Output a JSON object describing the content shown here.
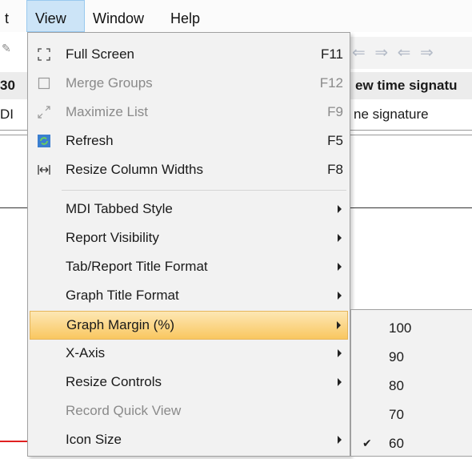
{
  "menubar": {
    "items": [
      {
        "label": "t"
      },
      {
        "label": "View"
      },
      {
        "label": "Window"
      },
      {
        "label": "Help"
      }
    ]
  },
  "background": {
    "header_left": "30",
    "header_right": "ew time signatu",
    "row_left": "DI",
    "row_right": "ne signature",
    "toolbar_arrows": [
      "⇐",
      "⇒",
      "⇐",
      "⇒"
    ]
  },
  "view_menu": {
    "items": [
      {
        "label": "Full Screen",
        "shortcut": "F11",
        "icon": "fullscreen-icon",
        "disabled": false
      },
      {
        "label": "Merge Groups",
        "shortcut": "F12",
        "icon": "checkbox-icon",
        "disabled": true
      },
      {
        "label": "Maximize List",
        "shortcut": "F9",
        "icon": "maximize-icon",
        "disabled": true
      },
      {
        "label": "Refresh",
        "shortcut": "F5",
        "icon": "refresh-icon",
        "disabled": false
      },
      {
        "label": "Resize Column Widths",
        "shortcut": "F8",
        "icon": "resize-columns-icon",
        "disabled": false
      },
      {
        "label": "MDI Tabbed Style",
        "submenu": true
      },
      {
        "label": "Report Visibility",
        "submenu": true
      },
      {
        "label": "Tab/Report Title Format",
        "submenu": true
      },
      {
        "label": "Graph Title Format",
        "submenu": true
      },
      {
        "label": "Graph Margin (%)",
        "submenu": true,
        "highlighted": true
      },
      {
        "label": "X-Axis",
        "submenu": true
      },
      {
        "label": "Resize Controls",
        "submenu": true
      },
      {
        "label": "Record Quick View",
        "disabled": true
      },
      {
        "label": "Icon Size",
        "submenu": true
      }
    ]
  },
  "graph_margin_submenu": {
    "options": [
      "100",
      "90",
      "80",
      "70",
      "60"
    ],
    "selected": "60"
  },
  "colors": {
    "highlight_top": "#fde7b4",
    "highlight_bottom": "#f9c760",
    "menu_bg": "#f2f2f2",
    "active_menubar": "#cce4f7"
  }
}
